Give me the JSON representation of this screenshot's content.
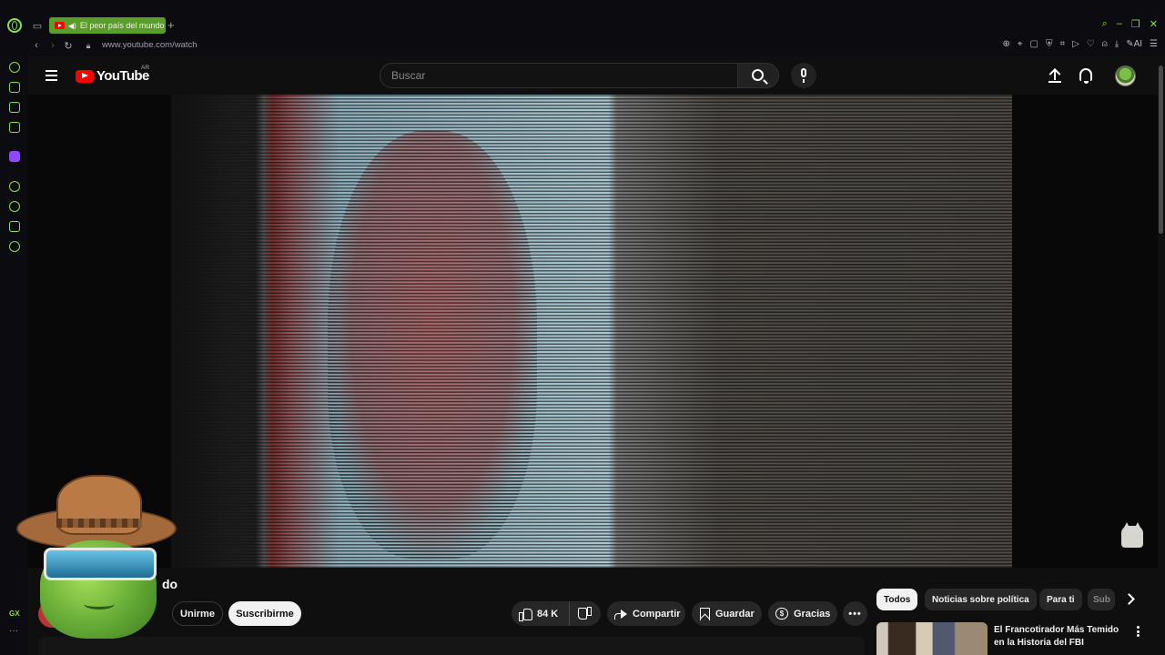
{
  "browser": {
    "tab_title": "El peor país del mundo",
    "new_tab_symbol": "+",
    "url": "www.youtube.com/watch",
    "ai_label": "AI",
    "sidebar_gx": "GX",
    "sidebar_more": "···",
    "window_controls": [
      "⌕",
      "–",
      "❐",
      "✕"
    ],
    "accent_color": "#8adf3d"
  },
  "header": {
    "logo_text": "YouTube",
    "region": "AR",
    "search_placeholder": "Buscar"
  },
  "video": {
    "title_visible": "do"
  },
  "actions": {
    "join_label": "Unirme",
    "subscribe_label": "Suscribirme",
    "likes": "84 K",
    "share_label": "Compartir",
    "save_label": "Guardar",
    "thanks_label": "Gracias",
    "more_label": "•••"
  },
  "chips": [
    {
      "label": "Todos"
    },
    {
      "label": "Noticias sobre política"
    },
    {
      "label": "Para ti"
    },
    {
      "label": "Sub"
    }
  ],
  "recommendation": {
    "title": "El Francotirador Más Temido en la Historia del FBI"
  },
  "icons": {
    "menu": "menu-icon",
    "search": "search-icon",
    "mic": "mic-icon",
    "upload": "upload-icon",
    "bell": "bell-icon",
    "like": "thumbs-up-icon",
    "dislike": "thumbs-down-icon",
    "share": "share-icon",
    "save": "bookmark-icon",
    "thanks": "heart-dollar-icon"
  }
}
